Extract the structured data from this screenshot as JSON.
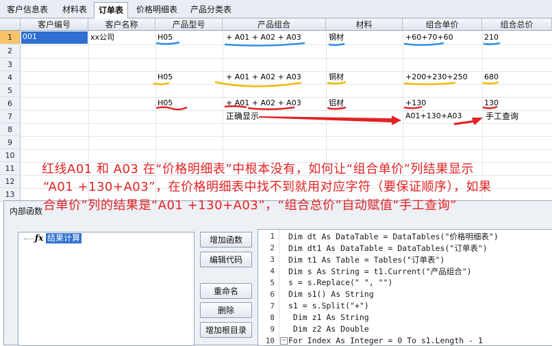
{
  "tabs": [
    {
      "label": "客户信息表",
      "active": false
    },
    {
      "label": "材料表",
      "active": false
    },
    {
      "label": "订单表",
      "active": true
    },
    {
      "label": "价格明细表",
      "active": false
    },
    {
      "label": "产品分类表",
      "active": false
    }
  ],
  "grid": {
    "columns": [
      "客户编号",
      "客户名称",
      "产品型号",
      "产品组合",
      "材料",
      "组合单价",
      "组合总价"
    ],
    "row_numbers": [
      "1",
      "2",
      "3",
      "4",
      "5",
      "6",
      "7",
      "8",
      "9",
      "10",
      "11",
      "12",
      "13"
    ],
    "rows": [
      {
        "id": "001",
        "name": "xx公司",
        "model": "H05",
        "combo": "+ A01 + A02 + A03",
        "material": "钢材",
        "unit_price": "+60+70+60",
        "total": "210"
      },
      {
        "model": "H05",
        "combo": "+ A01 + A02 + A03",
        "material": "铜材",
        "unit_price": "+200+230+250",
        "total": "680"
      },
      {
        "model": "H05",
        "combo": "+ A01 + A02 + A03",
        "material": "铝材",
        "unit_price": "+130",
        "total": "130"
      }
    ],
    "row7": {
      "note": "正确显示",
      "unit_price": "A01+130+A03",
      "total": "手工查询"
    }
  },
  "annotation": {
    "line1": "红线A01 和 A03 在“价格明细表”中根本没有，如何让“组合单价”列结果显示",
    "line2": "“A01 +130+A03”，在价格明细表中找不到就用对应字符（要保证顺序），如果",
    "line3": "合单价”列的结果是“A01 +130+A03”，“组合总价”自动赋值“手工查询”"
  },
  "colors": {
    "blue": "#2f8fe0",
    "yellow": "#f2b800",
    "red": "#e32222",
    "selection": "#2f6fd1"
  },
  "dialog": {
    "title": "内部函数",
    "tree_item": "结果计算",
    "tree_icon": "fx-icon",
    "buttons": [
      "增加函数",
      "编辑代码",
      "重命名",
      "删除",
      "增加根目录"
    ],
    "code_lines": [
      {
        "n": "1",
        "text": "Dim dt As DataTable = DataTables(\"价格明细表\")"
      },
      {
        "n": "2",
        "text": "Dim dt1 As DataTable = DataTables(\"订单表\")"
      },
      {
        "n": "3",
        "text": "Dim t1 As Table = Tables(\"订单表\")"
      },
      {
        "n": "4",
        "text": "Dim s As String = t1.Current(\"产品组合\")"
      },
      {
        "n": "5",
        "text": "s = s.Replace(\" \", \"\")"
      },
      {
        "n": "6",
        "text": "Dim s1() As String"
      },
      {
        "n": "7",
        "text": "s1 = s.Split(\"+\")"
      },
      {
        "n": "8",
        "text": " Dim z1 As String"
      },
      {
        "n": "9",
        "text": " Dim z2 As Double"
      },
      {
        "n": "10",
        "text": "For Index As Integer = 0 To s1.Length - 1"
      }
    ]
  }
}
